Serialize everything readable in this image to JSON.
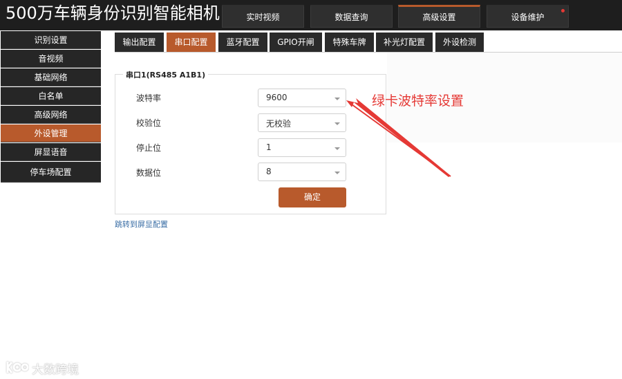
{
  "app": {
    "title": "500万车辆身份识别智能相机"
  },
  "top_nav": [
    {
      "label": "实时视频",
      "active": false
    },
    {
      "label": "数据查询",
      "active": false
    },
    {
      "label": "高级设置",
      "active": true
    },
    {
      "label": "设备维护",
      "active": false,
      "has_notification_dot": true
    }
  ],
  "sidebar": {
    "items": [
      {
        "label": "识别设置",
        "active": false
      },
      {
        "label": "音视频",
        "active": false
      },
      {
        "label": "基础网络",
        "active": false
      },
      {
        "label": "白名单",
        "active": false
      },
      {
        "label": "高级网络",
        "active": false
      },
      {
        "label": "外设管理",
        "active": true
      },
      {
        "label": "屏显语音",
        "active": false
      },
      {
        "label": "停车场配置",
        "active": false
      }
    ]
  },
  "sub_tabs": [
    {
      "label": "输出配置",
      "active": false
    },
    {
      "label": "串口配置",
      "active": true
    },
    {
      "label": "蓝牙配置",
      "active": false
    },
    {
      "label": "GPIO开闸",
      "active": false
    },
    {
      "label": "特殊车牌",
      "active": false
    },
    {
      "label": "补光灯配置",
      "active": false
    },
    {
      "label": "外设检测",
      "active": false
    }
  ],
  "serial_port": {
    "legend": "串口1(RS485 A1B1)",
    "fields": [
      {
        "label": "波特率",
        "value": "9600"
      },
      {
        "label": "校验位",
        "value": "无校验"
      },
      {
        "label": "停止位",
        "value": "1"
      },
      {
        "label": "数据位",
        "value": "8"
      }
    ],
    "confirm_label": "确定"
  },
  "link": {
    "label": "跳转到屏显配置"
  },
  "annotation": {
    "text": "绿卡波特率设置"
  },
  "watermark": {
    "text": "大数跨境"
  },
  "colors": {
    "accent": "#b85a2c",
    "dark": "#1e1e1e",
    "annotation": "#e53935",
    "link": "#3a6ea5"
  }
}
